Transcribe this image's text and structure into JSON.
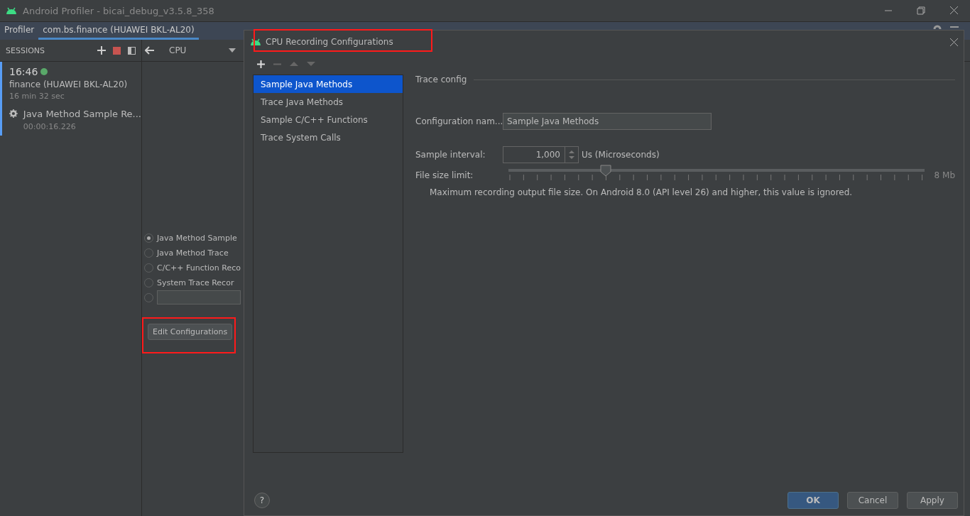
{
  "window": {
    "title": "Android Profiler - bicai_debug_v3.5.8_358"
  },
  "tabs": [
    {
      "label": "Profiler",
      "selected": false
    },
    {
      "label": "com.bs.finance (HUAWEI BKL-AL20)",
      "selected": true
    }
  ],
  "sessions": {
    "header": "SESSIONS",
    "session": {
      "time": "16:46",
      "live": true,
      "name": "finance (HUAWEI BKL-AL20)",
      "duration": "16 min 32 sec",
      "selected": true,
      "recording": {
        "label": "Java Method Sample Re...",
        "time": "00:00:16.226"
      }
    }
  },
  "cpu_panel": {
    "dropdown": "CPU",
    "options": [
      {
        "kind": "radio",
        "label": "Java Method Sample",
        "selected": true
      },
      {
        "kind": "radio",
        "label": "Java Method Trace",
        "selected": false
      },
      {
        "kind": "radio",
        "label": "C/C++ Function Reco",
        "selected": false
      },
      {
        "kind": "radio",
        "label": "System Trace Recor",
        "selected": false
      },
      {
        "kind": "field",
        "selected": false
      }
    ],
    "edit_button": {
      "label": "Edit Configurations",
      "highlighted": true
    }
  },
  "dialog": {
    "title": "CPU Recording Configurations",
    "title_highlighted": true,
    "configurations": [
      {
        "label": "Sample Java Methods",
        "selected": true
      },
      {
        "label": "Trace Java Methods",
        "selected": false
      },
      {
        "label": "Sample C/C++ Functions",
        "selected": false
      },
      {
        "label": "Trace System Calls",
        "selected": false
      }
    ],
    "section": "Trace config",
    "name_label": "Configuration nam...",
    "name_value": "Sample Java Methods",
    "interval_label": "Sample interval:",
    "interval_value": "1,000",
    "interval_unit": "Us (Microseconds)",
    "size_label": "File size limit:",
    "size_slider": {
      "level": 0.227
    },
    "size_reading": "8 Mb",
    "size_note": "Maximum recording output file size. On Android 8.0 (API level 26) and higher, this value is ignored.",
    "help": "?",
    "buttons": [
      {
        "label": "OK",
        "default": true
      },
      {
        "label": "Cancel",
        "default": false
      },
      {
        "label": "Apply",
        "default": false
      }
    ]
  }
}
